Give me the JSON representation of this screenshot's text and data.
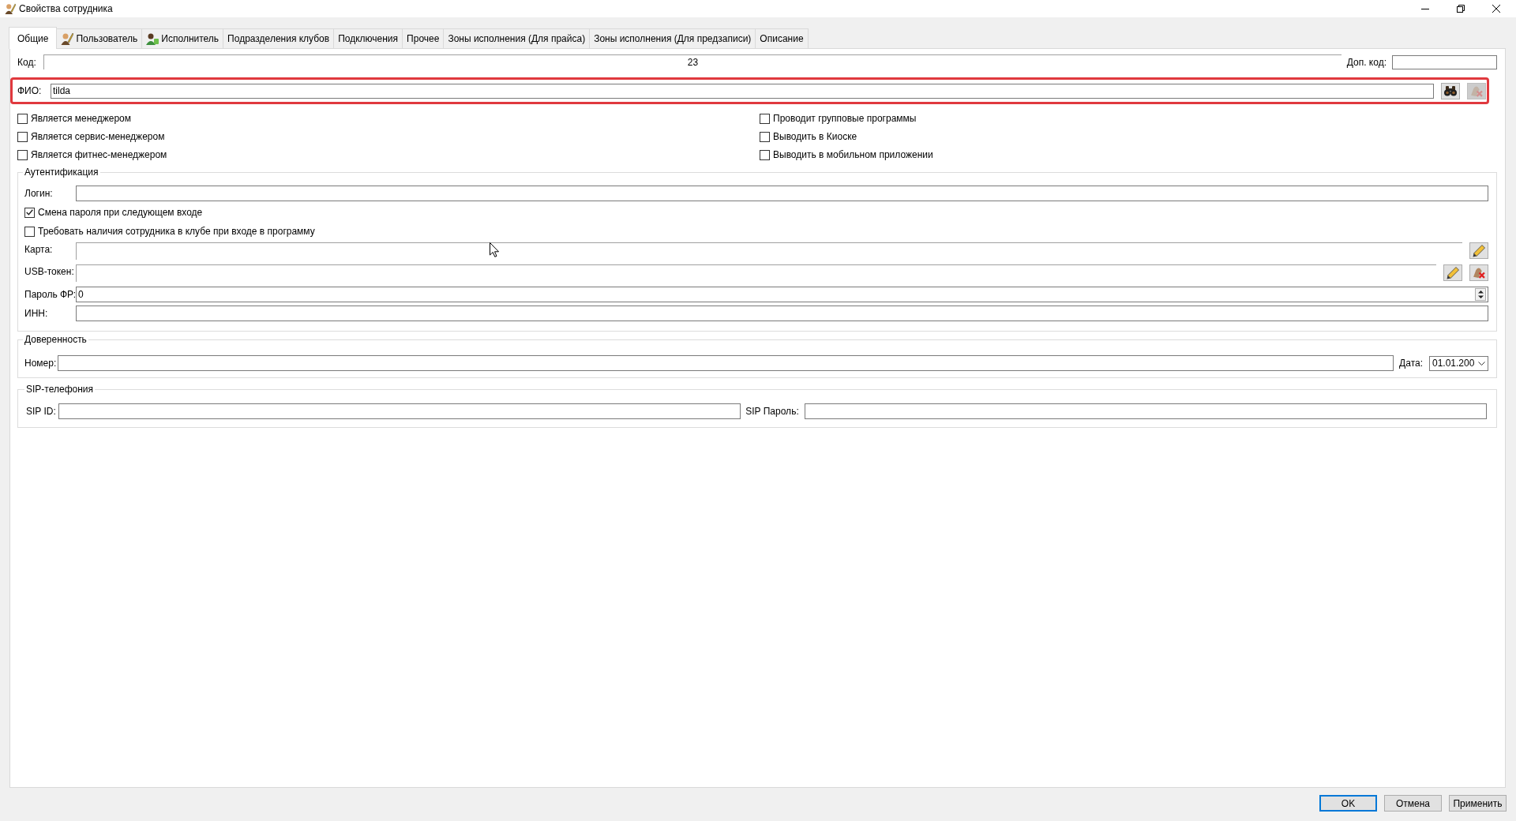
{
  "window": {
    "title": "Свойства сотрудника"
  },
  "tabs": [
    {
      "label": "Общие",
      "kind": "plain",
      "selected": true
    },
    {
      "label": "Пользователь",
      "kind": "user",
      "selected": false
    },
    {
      "label": "Исполнитель",
      "kind": "performer",
      "selected": false
    },
    {
      "label": "Подразделения клубов",
      "kind": "plain",
      "selected": false
    },
    {
      "label": "Подключения",
      "kind": "plain",
      "selected": false
    },
    {
      "label": "Прочее",
      "kind": "plain",
      "selected": false
    },
    {
      "label": "Зоны исполнения (Для прайса)",
      "kind": "plain",
      "selected": false
    },
    {
      "label": "Зоны исполнения (Для предзаписи)",
      "kind": "plain",
      "selected": false
    },
    {
      "label": "Описание",
      "kind": "plain",
      "selected": false
    }
  ],
  "code": {
    "label": "Код:",
    "value": "23"
  },
  "extra_code": {
    "label": "Доп. код:"
  },
  "full_name": {
    "label": "ФИО:",
    "value": "tilda",
    "highlighted": true,
    "buttons": [
      {
        "kind": "search",
        "disabled": false
      },
      {
        "kind": "clear",
        "disabled": true
      }
    ]
  },
  "flags_left": [
    {
      "label": "Является менеджером",
      "checked": false
    },
    {
      "label": "Является сервис-менеджером",
      "checked": false
    },
    {
      "label": "Является фитнес-менеджером",
      "checked": false
    }
  ],
  "flags_right": [
    {
      "label": "Проводит групповые программы",
      "checked": false
    },
    {
      "label": "Выводить в Киоске",
      "checked": false
    },
    {
      "label": "Выводить в мобильном приложении",
      "checked": false
    }
  ],
  "authentication": {
    "title": "Аутентификация",
    "login": {
      "label": "Логин:"
    },
    "options": [
      {
        "label": "Смена пароля при следующем входе",
        "checked": true
      },
      {
        "label": "Требовать наличия сотрудника в клубе при входе в программу",
        "checked": false
      }
    ],
    "card": {
      "label": "Карта:",
      "buttons": [
        {
          "kind": "edit",
          "disabled": false
        }
      ]
    },
    "usb_token": {
      "label": "USB-токен:",
      "buttons": [
        {
          "kind": "edit",
          "disabled": false
        },
        {
          "kind": "clear",
          "disabled": false
        }
      ]
    },
    "fr_password": {
      "label": "Пароль ФР:",
      "value": "0"
    },
    "inn": {
      "label": "ИНН:"
    }
  },
  "power_of_attorney": {
    "title": "Доверенность",
    "number": {
      "label": "Номер:"
    },
    "date": {
      "label": "Дата:",
      "value": "01.01.200"
    }
  },
  "sip": {
    "title": "SIP-телефония",
    "sip_id": {
      "label": "SIP ID:"
    },
    "sip_password": {
      "label": "SIP Пароль:"
    }
  },
  "footer_buttons": [
    {
      "label": "OK",
      "focused": true
    },
    {
      "label": "Отмена",
      "focused": false
    },
    {
      "label": "Применить",
      "focused": false
    }
  ]
}
